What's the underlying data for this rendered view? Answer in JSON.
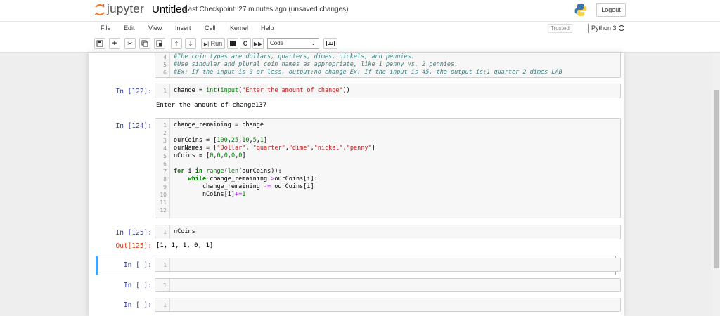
{
  "header": {
    "logo_text": "jupyter",
    "notebook_name": "Untitled",
    "checkpoint": "Last Checkpoint: 27 minutes ago  (unsaved changes)",
    "logout_label": "Logout"
  },
  "menu": {
    "items": [
      "File",
      "Edit",
      "View",
      "Insert",
      "Cell",
      "Kernel",
      "Help"
    ],
    "trusted_label": "Trusted",
    "kernel_name": "Python 3"
  },
  "toolbar": {
    "run_label": "Run",
    "cell_type": "Code"
  },
  "cells": [
    {
      "prompt": "",
      "lines": [
        {
          "n": "4",
          "text": "#The coin types are dollars, quarters, dimes, nickels, and pennies."
        },
        {
          "n": "5",
          "text": "#Use singular and plural coin names as appropriate, like 1 penny vs. 2 pennies."
        },
        {
          "n": "6",
          "text": "#Ex: If the input is 0 or less, output:no change Ex: If the input is 45, the output is:1 quarter 2 dimes LAB"
        }
      ]
    },
    {
      "prompt": "In [122]:",
      "lines": [
        {
          "n": "1",
          "text": "change = int(input(\"Enter the amount of change\"))"
        }
      ],
      "output": "Enter the amount of change137"
    },
    {
      "prompt": "In [124]:",
      "lines": [
        {
          "n": "1",
          "text": "change_remaining = change"
        },
        {
          "n": "2",
          "text": ""
        },
        {
          "n": "3",
          "text": "ourCoins = [100,25,10,5,1]"
        },
        {
          "n": "4",
          "text": "ourNames = [\"Dollar\", \"quarter\",\"dime\",\"nickel\",\"penny\"]"
        },
        {
          "n": "5",
          "text": "nCoins = [0,0,0,0,0]"
        },
        {
          "n": "6",
          "text": ""
        },
        {
          "n": "7",
          "text": "for i in range(len(ourCoins)):"
        },
        {
          "n": "8",
          "text": "    while change_remaining >ourCoins[i]:"
        },
        {
          "n": "9",
          "text": "        change_remaining -= ourCoins[i]"
        },
        {
          "n": "10",
          "text": "        nCoins[i]+=1"
        },
        {
          "n": "11",
          "text": ""
        },
        {
          "n": "12",
          "text": ""
        }
      ]
    },
    {
      "prompt": "In [125]:",
      "lines": [
        {
          "n": "1",
          "text": "nCoins"
        }
      ],
      "out_prompt": "Out[125]:",
      "output": "[1, 1, 1, 0, 1]"
    },
    {
      "prompt": "In [ ]:",
      "lines": [
        {
          "n": "1",
          "text": ""
        }
      ]
    },
    {
      "prompt": "In [ ]:",
      "lines": [
        {
          "n": "1",
          "text": ""
        }
      ]
    },
    {
      "prompt": "In [ ]:",
      "lines": [
        {
          "n": "1",
          "text": ""
        }
      ]
    }
  ]
}
